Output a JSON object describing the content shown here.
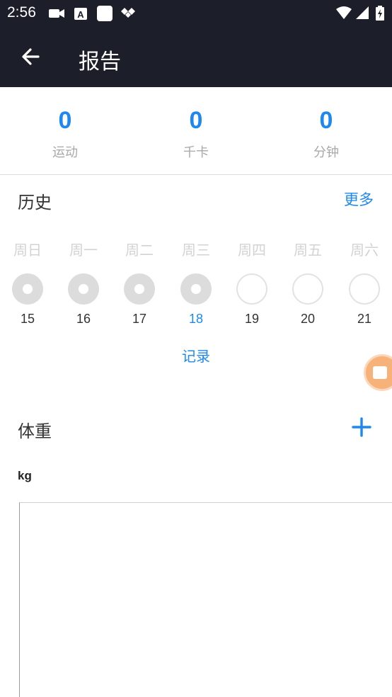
{
  "status_bar": {
    "time": "2:56"
  },
  "app_bar": {
    "title": "报告"
  },
  "stats": [
    {
      "value": "0",
      "label": "运动"
    },
    {
      "value": "0",
      "label": "千卡"
    },
    {
      "value": "0",
      "label": "分钟"
    }
  ],
  "history": {
    "title": "历史",
    "more": "更多",
    "days": [
      {
        "weekday": "周日",
        "date": "15",
        "state": "done"
      },
      {
        "weekday": "周一",
        "date": "16",
        "state": "done"
      },
      {
        "weekday": "周二",
        "date": "17",
        "state": "done"
      },
      {
        "weekday": "周三",
        "date": "18",
        "state": "done",
        "today": true
      },
      {
        "weekday": "周四",
        "date": "19",
        "state": "empty"
      },
      {
        "weekday": "周五",
        "date": "20",
        "state": "empty"
      },
      {
        "weekday": "周六",
        "date": "21",
        "state": "empty"
      }
    ],
    "record": "记录"
  },
  "weight": {
    "title": "体重",
    "unit": "kg"
  },
  "colors": {
    "accent": "#1e88f0",
    "header_bg": "#1c1f2a"
  }
}
